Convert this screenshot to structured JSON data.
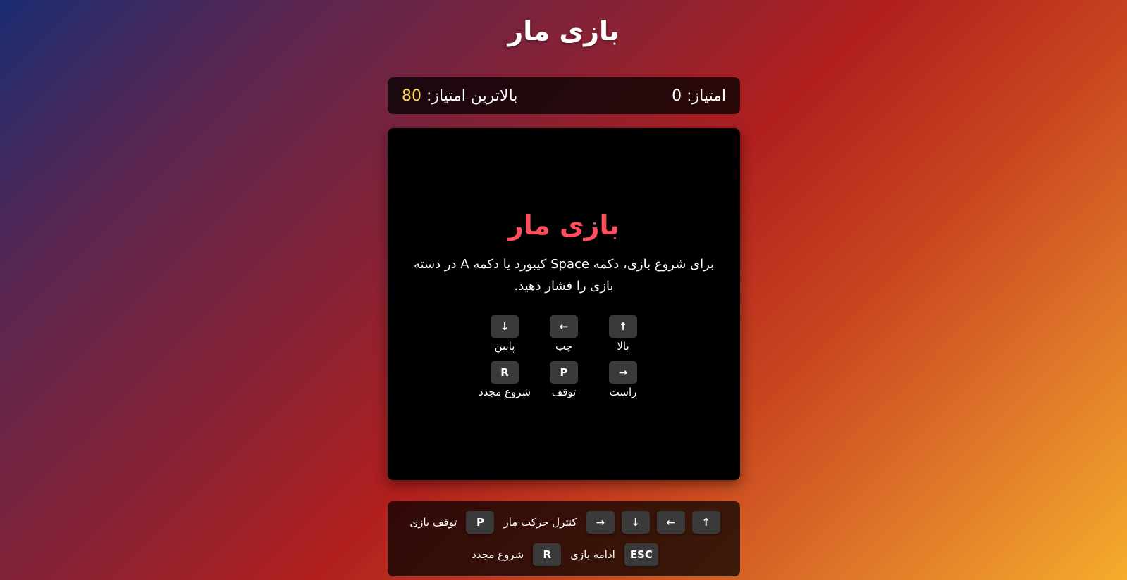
{
  "page": {
    "title": "بازی مار"
  },
  "scores": {
    "score_label": "امتیاز: ",
    "score_value": "0",
    "high_label": "بالاترین امتیاز: ",
    "high_value": "80"
  },
  "overlay": {
    "title": "بازی مار",
    "instructions": "برای شروع بازی، دکمه Space کیبورد یا دکمه A در دسته بازی را فشار دهید.",
    "keys": [
      {
        "key": "↑",
        "label": "بالا"
      },
      {
        "key": "←",
        "label": "چپ"
      },
      {
        "key": "↓",
        "label": "پایین"
      },
      {
        "key": "→",
        "label": "راست"
      },
      {
        "key": "P",
        "label": "توقف"
      },
      {
        "key": "R",
        "label": "شروع مجدد"
      }
    ]
  },
  "help": {
    "row1": {
      "arrows": [
        "↑",
        "←",
        "↓",
        "→"
      ],
      "move_label": "کنترل حرکت مار",
      "pause_key": "P",
      "pause_label": "توقف بازی"
    },
    "row2": {
      "esc_key": "ESC",
      "esc_label": "ادامه بازی",
      "restart_key": "R",
      "restart_label": "شروع مجدد"
    }
  },
  "colors": {
    "overlay_title": "#ff4d5e",
    "high_score": "#ffd54f",
    "board": "#000000"
  }
}
